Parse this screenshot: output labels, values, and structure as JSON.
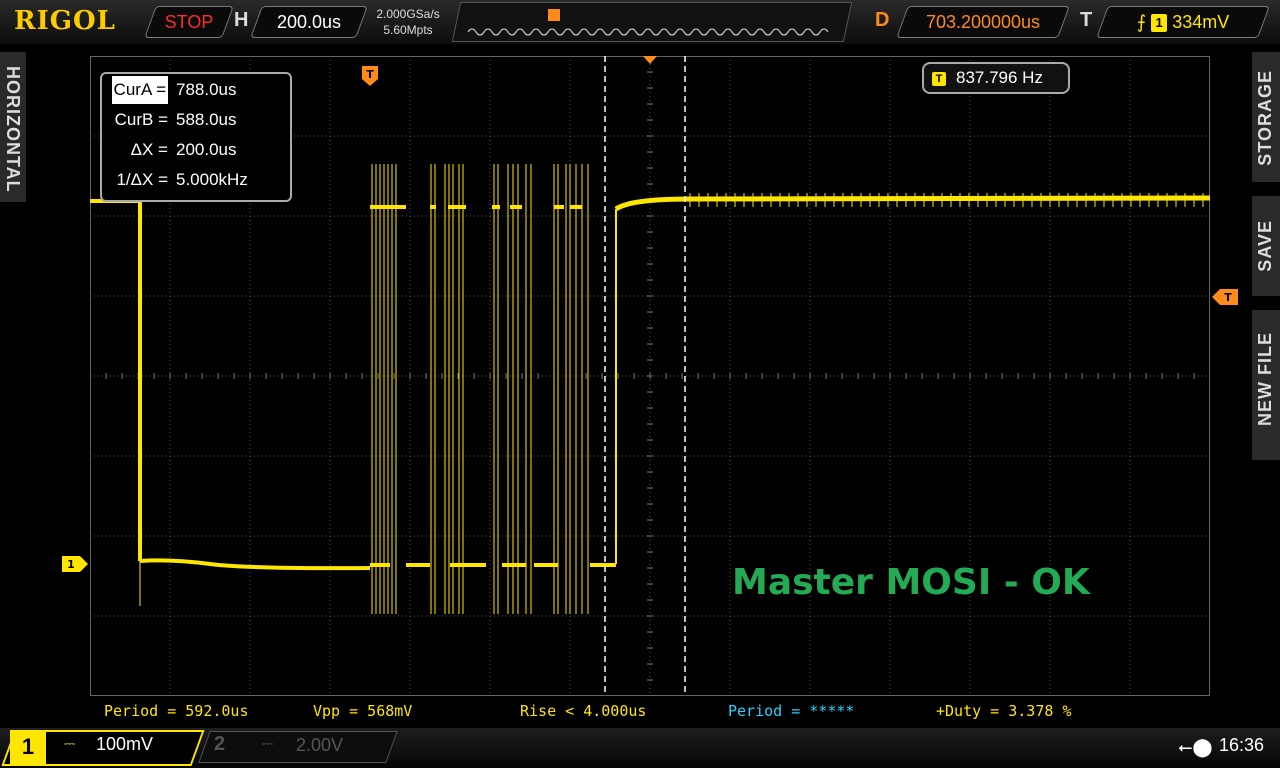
{
  "brand": {
    "logo": "RIGOL"
  },
  "header": {
    "run_state": "STOP",
    "horizontal_label": "H",
    "timebase": "200.0us",
    "sample_rate": "2.000GSa/s",
    "memory_depth": "5.60Mpts",
    "delay_label": "D",
    "delay_value": "703.200000us",
    "trigger_label": "T",
    "trigger_channel": "1",
    "trigger_level": "334mV"
  },
  "side": {
    "left_tab": "HORIZONTAL",
    "right_tabs": [
      "STORAGE",
      "SAVE",
      "NEW FILE"
    ]
  },
  "cursors": {
    "rows": [
      {
        "label": "CurA =",
        "value": "788.0us"
      },
      {
        "label": "CurB =",
        "value": "588.0us"
      },
      {
        "label": "ΔX =",
        "value": "200.0us"
      },
      {
        "label": "1/ΔX =",
        "value": "5.000kHz"
      }
    ]
  },
  "trigger_freq": {
    "icon": "T",
    "value": "837.796 Hz"
  },
  "annotation": "Master MOSI - OK",
  "channel_marker": "1",
  "trigger_marker": "T",
  "measurements": [
    {
      "text": "Period = 592.0us",
      "color": "#ffe600"
    },
    {
      "text": "Vpp = 568mV",
      "color": "#ffe600"
    },
    {
      "text": "Rise < 4.000us",
      "color": "#ffe600"
    },
    {
      "text": "Period = *****",
      "color": "#22d3ff"
    },
    {
      "text": "+Duty = 3.378 %",
      "color": "#ffe600"
    }
  ],
  "channels": [
    {
      "num": "1",
      "coupling_icon": "dc-coupling-icon",
      "scale": "100mV",
      "active": true
    },
    {
      "num": "2",
      "coupling_icon": "dc-coupling-icon",
      "scale": "2.00V",
      "active": false
    }
  ],
  "status": {
    "usb_icon": "usb-icon",
    "time": "16:36"
  },
  "colors": {
    "trace": "#ffe600",
    "delay": "#ff8c1a",
    "annotation": "#22aa55",
    "stop": "#ff2b2b"
  }
}
